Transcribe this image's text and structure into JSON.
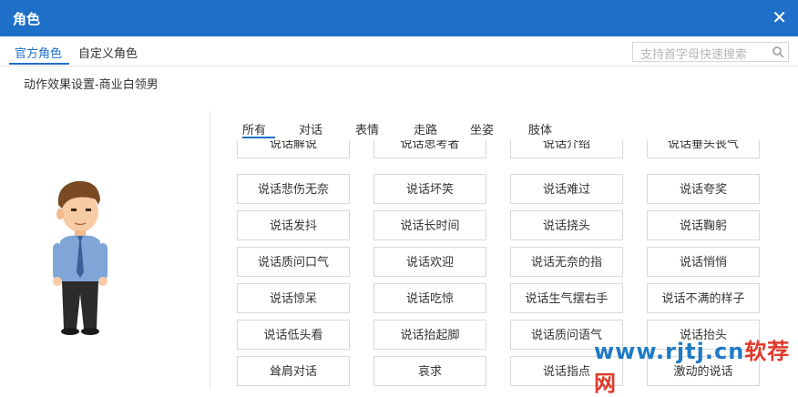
{
  "window": {
    "title": "角色",
    "close_glyph": "✕"
  },
  "top_tabs": [
    {
      "label": "官方角色",
      "active": true
    },
    {
      "label": "自定义角色",
      "active": false
    }
  ],
  "search": {
    "placeholder": "支持首字母快速搜索",
    "icon": "search-icon"
  },
  "subtitle": "动作效果设置-商业白领男",
  "category_tabs": [
    {
      "label": "所有",
      "active": true
    },
    {
      "label": "对话",
      "active": false
    },
    {
      "label": "表情",
      "active": false
    },
    {
      "label": "走路",
      "active": false
    },
    {
      "label": "坐姿",
      "active": false
    },
    {
      "label": "肢体",
      "active": false
    }
  ],
  "actions": [
    [
      "说话解说",
      "说话思考者",
      "说话介绍",
      "说话垂头丧气"
    ],
    [
      "说话悲伤无奈",
      "说话坏笑",
      "说话难过",
      "说话夸奖"
    ],
    [
      "说话发抖",
      "说话长时间",
      "说话挠头",
      "说话鞠躬"
    ],
    [
      "说话质问口气",
      "说话欢迎",
      "说话无奈的指",
      "说话悄悄"
    ],
    [
      "说话惊呆",
      "说话吃惊",
      "说话生气摆右手",
      "说话不满的样子"
    ],
    [
      "说话低头看",
      "说话抬起脚",
      "说话质问语气",
      "说话抬头"
    ],
    [
      "耸肩对话",
      "哀求",
      "说话指点",
      "激动的说话"
    ]
  ],
  "watermark": {
    "part1": "www.rjtj.cn",
    "part2": "软荐网"
  },
  "colors": {
    "accent": "#1e6fc8",
    "border": "#d9d9d9"
  }
}
